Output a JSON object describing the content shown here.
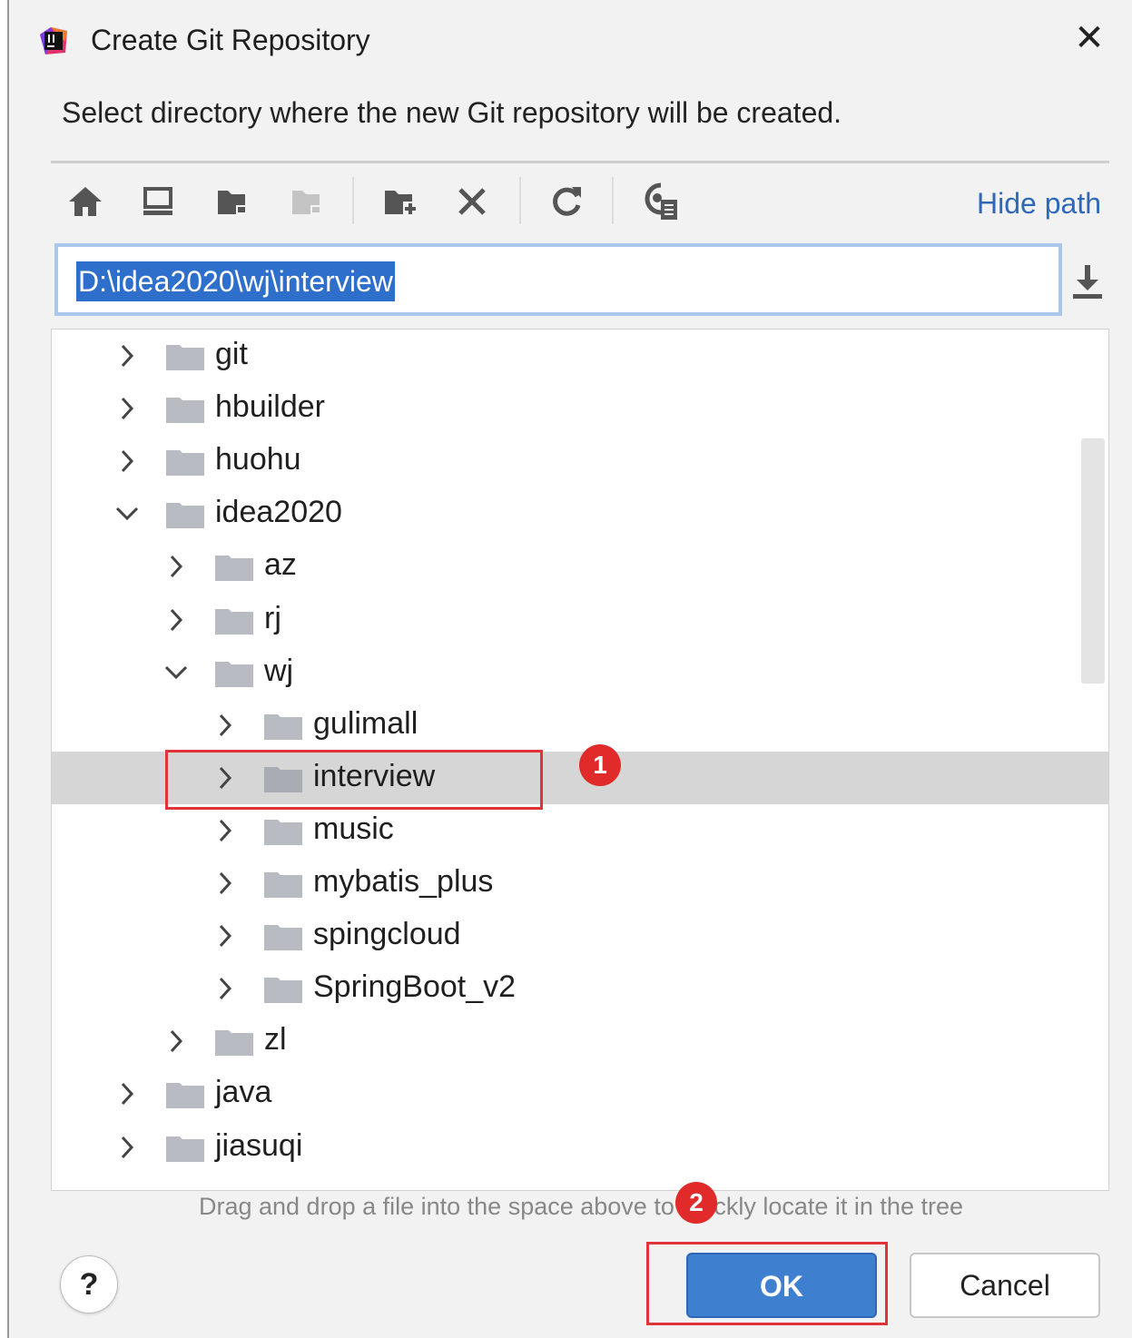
{
  "dialog": {
    "title": "Create Git Repository",
    "subtitle": "Select directory where the new Git repository will be created.",
    "close_icon": "close-icon"
  },
  "toolbar": {
    "buttons": [
      "home-icon",
      "desktop-icon",
      "project-folder-icon",
      "module-folder-icon",
      "new-folder-icon",
      "delete-icon",
      "refresh-icon",
      "show-hidden-icon"
    ],
    "hide_path_label": "Hide path"
  },
  "path": {
    "value": "D:\\idea2020\\wj\\interview"
  },
  "tree": {
    "items": [
      {
        "label": "git",
        "expanded": false
      },
      {
        "label": "hbuilder",
        "expanded": false
      },
      {
        "label": "huohu",
        "expanded": false
      },
      {
        "label": "idea2020",
        "expanded": true
      },
      {
        "label": "az",
        "expanded": false
      },
      {
        "label": "rj",
        "expanded": false
      },
      {
        "label": "wj",
        "expanded": true
      },
      {
        "label": "gulimall",
        "expanded": false
      },
      {
        "label": "interview",
        "expanded": false,
        "selected": true
      },
      {
        "label": "music",
        "expanded": false
      },
      {
        "label": "mybatis_plus",
        "expanded": false
      },
      {
        "label": "spingcloud",
        "expanded": false
      },
      {
        "label": "SpringBoot_v2",
        "expanded": false
      },
      {
        "label": "zl",
        "expanded": false
      },
      {
        "label": "java",
        "expanded": false
      },
      {
        "label": "jiasuqi",
        "expanded": false
      }
    ]
  },
  "hint": "Drag and drop a file into the space above to quickly locate it in the tree",
  "buttons": {
    "help": "?",
    "ok": "OK",
    "cancel": "Cancel"
  },
  "annotations": {
    "badge1": "1",
    "badge2": "2"
  },
  "colors": {
    "accent": "#2f68b8",
    "selection": "#2e6fcc",
    "annotation": "#e12a2a"
  }
}
